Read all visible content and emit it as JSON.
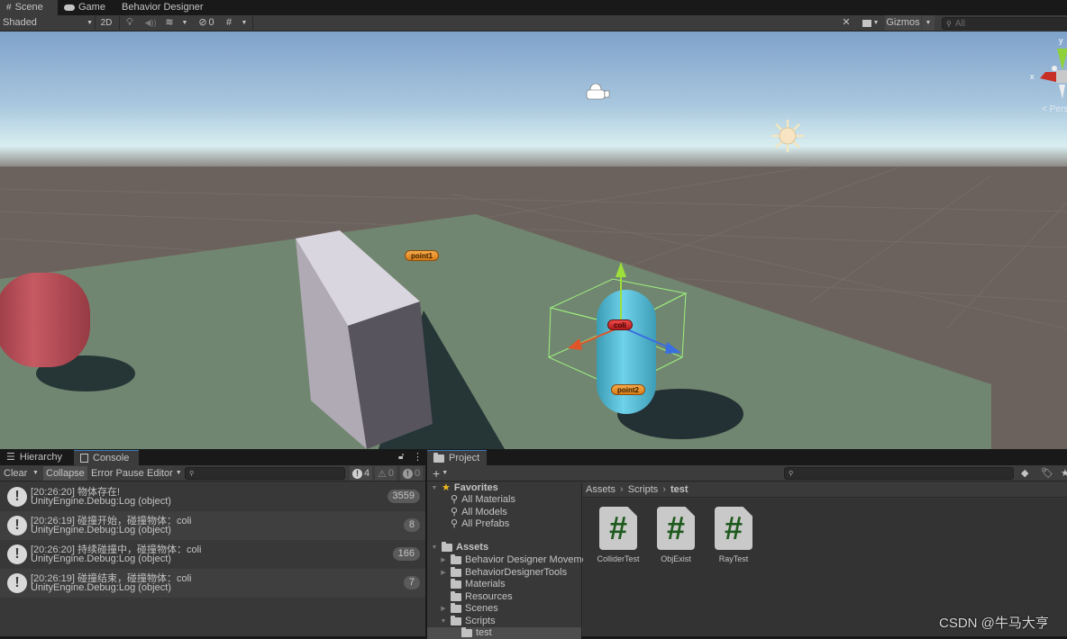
{
  "scene_tabs": [
    {
      "label": "Scene",
      "icon": "grid-icon",
      "active": true
    },
    {
      "label": "Game",
      "icon": "gamepad-icon",
      "active": false
    },
    {
      "label": "Behavior Designer",
      "active": false
    }
  ],
  "scene_toolbar": {
    "draw_mode": "Shaded",
    "mode_2d": "2D",
    "hidden_count": "0",
    "gizmos": "Gizmos",
    "search_placeholder": "All"
  },
  "scene": {
    "labels": [
      "point1",
      "point2",
      "coli"
    ],
    "axis_x": "x",
    "axis_y": "y",
    "persp": "< Persp",
    "colors": {
      "sky_top": "#7fa3cc",
      "ground": "#6c605b",
      "plane": "#718670",
      "capsule": "#5fc4dc",
      "red_capsule": "#b34c55"
    }
  },
  "console": {
    "tabs": [
      {
        "label": "Hierarchy",
        "active": false
      },
      {
        "label": "Console",
        "active": true
      }
    ],
    "toolbar": {
      "clear": "Clear",
      "collapse": "Collapse",
      "error_pause": "Error Pause",
      "editor": "Editor"
    },
    "counts": {
      "log": "4",
      "warning": "0",
      "error": "0"
    },
    "entries": [
      {
        "line1": "[20:26:20] 物体存在!",
        "line2": "UnityEngine.Debug:Log (object)",
        "count": "3559"
      },
      {
        "line1": "[20:26:19] 碰撞开始，碰撞物体：coli",
        "line2": "UnityEngine.Debug:Log (object)",
        "count": "8"
      },
      {
        "line1": "[20:26:20] 持续碰撞中，碰撞物体：coli",
        "line2": "UnityEngine.Debug:Log (object)",
        "count": "166"
      },
      {
        "line1": "[20:26:19] 碰撞结束，碰撞物体：coli",
        "line2": "UnityEngine.Debug:Log (object)",
        "count": "7"
      }
    ]
  },
  "project": {
    "tab": "Project",
    "add": "+",
    "breadcrumb": [
      "Assets",
      "Scripts",
      "test"
    ],
    "favorites": {
      "label": "Favorites",
      "items": [
        "All Materials",
        "All Models",
        "All Prefabs"
      ]
    },
    "assets": {
      "label": "Assets",
      "folders": [
        {
          "label": "Behavior Designer Moveme",
          "expandable": true
        },
        {
          "label": "BehaviorDesignerTools",
          "expandable": true
        },
        {
          "label": "Materials",
          "expandable": false
        },
        {
          "label": "Resources",
          "expandable": false
        },
        {
          "label": "Scenes",
          "expandable": true
        },
        {
          "label": "Scripts",
          "expandable": true,
          "expanded": true
        },
        {
          "label": "test",
          "expandable": false,
          "selected": true
        }
      ]
    },
    "files": [
      {
        "label": "ColliderTest",
        "glyph": "#"
      },
      {
        "label": "ObjExist",
        "glyph": "#"
      },
      {
        "label": "RayTest",
        "glyph": "#"
      }
    ]
  },
  "watermark": "CSDN @牛马大亨"
}
